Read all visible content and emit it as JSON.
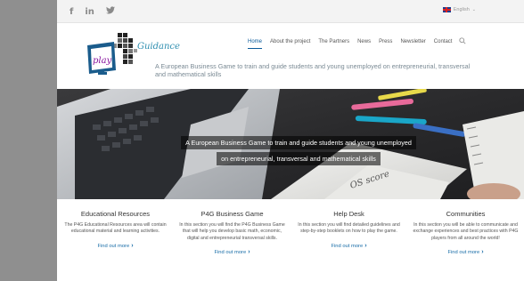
{
  "topbar": {
    "social": [
      {
        "icon": "facebook-icon",
        "glyph": "f"
      },
      {
        "icon": "linkedin-icon",
        "glyph": "in"
      },
      {
        "icon": "twitter-icon",
        "glyph": "𝕪"
      }
    ],
    "language": {
      "label": "English",
      "flag": "uk-flag-icon"
    }
  },
  "header": {
    "logo": {
      "text": "Guidance",
      "badge": "play"
    },
    "nav": [
      {
        "label": "Home",
        "active": true
      },
      {
        "label": "About the project",
        "active": false
      },
      {
        "label": "The Partners",
        "active": false
      },
      {
        "label": "News",
        "active": false
      },
      {
        "label": "Press",
        "active": false
      },
      {
        "label": "Newsletter",
        "active": false
      },
      {
        "label": "Contact",
        "active": false
      }
    ],
    "tagline": "A European Business Game to train and guide students and young unemployed on entrepreneurial, transversal and mathematical skills"
  },
  "hero": {
    "caption_line1": "A European Business Game to train and guide students and young unemployed",
    "caption_line2": "on entrepreneurial, transversal and mathematical skills"
  },
  "features": [
    {
      "title": "Educational Resources",
      "description": "The P4G Educational Resources area will contain educational material and learning activities.",
      "link": "Find out more"
    },
    {
      "title": "P4G Business Game",
      "description": "In this section you will find the P4G Business Game that will help you develop basic math, economic, digital and entrepreneurial transversal skills.",
      "link": "Find out more"
    },
    {
      "title": "Help Desk",
      "description": "In this section you will find detailed guidelines and step-by-step booklets on how to play the game.",
      "link": "Find out more"
    },
    {
      "title": "Communities",
      "description": "In this section you will be able to communicate and exchange experiences and best practices with P4G players from all around the world!",
      "link": "Find out more"
    }
  ],
  "colors": {
    "accent": "#0a5a9a",
    "link": "#1a6ea8",
    "tagline": "#7a8a94",
    "backdrop": "#8f8f8f"
  }
}
